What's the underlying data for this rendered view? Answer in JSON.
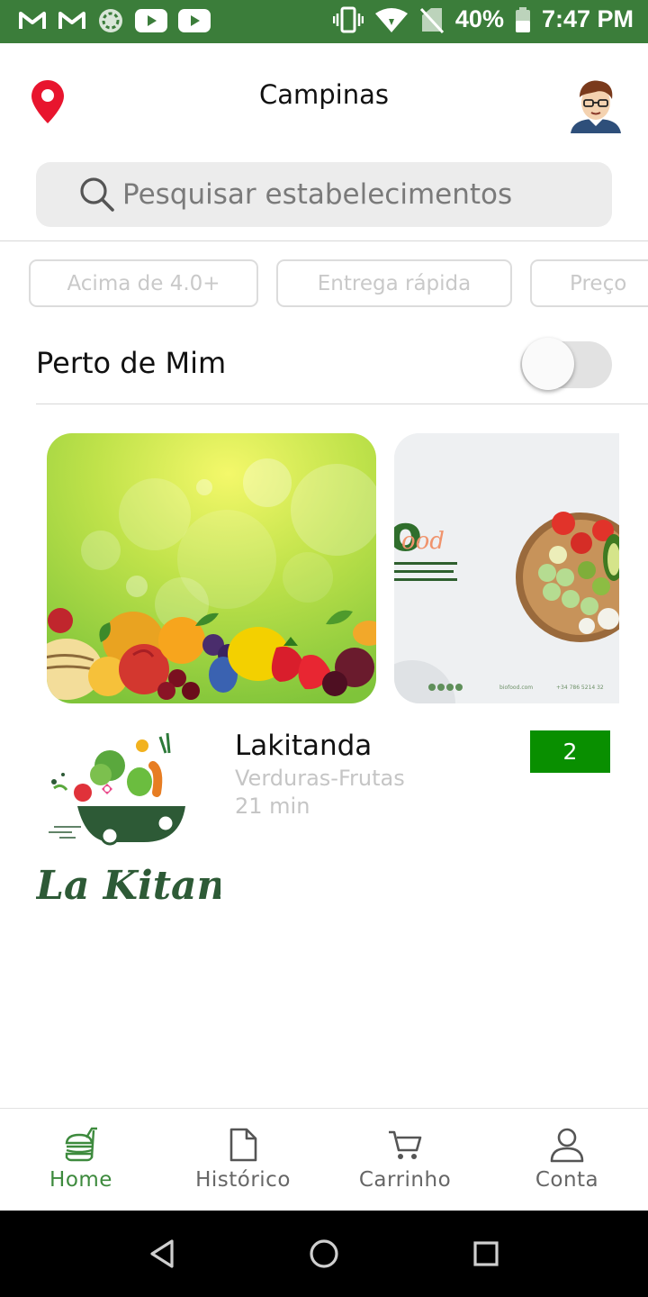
{
  "status_bar": {
    "battery": "40%",
    "time": "7:47 PM",
    "left_icons": [
      "gmail-icon",
      "gmail-icon",
      "sync-icon",
      "youtube-icon",
      "youtube-icon"
    ],
    "right_icons": [
      "vibrate-icon",
      "wifi-icon",
      "no-signal-icon",
      "battery-icon"
    ]
  },
  "header": {
    "city": "Campinas",
    "location_icon": "map-pin-icon",
    "avatar_icon": "user-avatar"
  },
  "search": {
    "placeholder": "Pesquisar estabelecimentos"
  },
  "filters": [
    {
      "label": "Acima de 4.0+"
    },
    {
      "label": "Entrega rápida"
    },
    {
      "label": "Preço"
    }
  ],
  "near_me": {
    "label": "Perto de Mim",
    "enabled": false
  },
  "banners": [
    {
      "name": "fruits-banner"
    },
    {
      "name": "biofood-banner",
      "text_partial": "ood",
      "footer_site": "biofood.com",
      "footer_phone": "+34 786 5214 32"
    }
  ],
  "store": {
    "name": "Lakitanda",
    "category": "Verduras-Frutas",
    "time": "21 min",
    "badge": "2",
    "logo_text": "La Kitanda"
  },
  "bottom_nav": [
    {
      "label": "Home",
      "icon": "burger-icon",
      "active": true
    },
    {
      "label": "Histórico",
      "icon": "document-icon",
      "active": false
    },
    {
      "label": "Carrinho",
      "icon": "cart-icon",
      "active": false
    },
    {
      "label": "Conta",
      "icon": "person-icon",
      "active": false
    }
  ],
  "colors": {
    "status_bar": "#3b7d3a",
    "accent_green": "#3d8a3d",
    "badge_green": "#098f00",
    "pin_red": "#e8152e"
  }
}
